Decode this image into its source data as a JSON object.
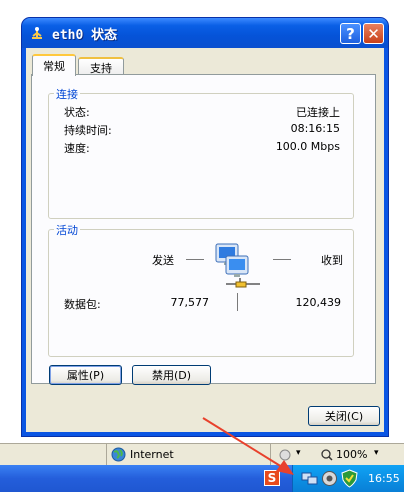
{
  "window": {
    "title": "eth0 状态",
    "help_label": "?",
    "close_label": "✕"
  },
  "tabs": [
    {
      "label": "常规"
    },
    {
      "label": "支持"
    }
  ],
  "connection": {
    "group_label": "连接",
    "rows": [
      {
        "label": "状态:",
        "value": "已连接上"
      },
      {
        "label": "持续时间:",
        "value": "08:16:15"
      },
      {
        "label": "速度:",
        "value": "100.0 Mbps"
      }
    ]
  },
  "activity": {
    "group_label": "活动",
    "sent_label": "发送",
    "received_label": "收到",
    "packets_label": "数据包:",
    "sent_packets": "77,577",
    "received_packets": "120,439"
  },
  "buttons": {
    "properties": "属性(P)",
    "disable": "禁用(D)",
    "close": "关闭(C)"
  },
  "statusbar": {
    "zone": "Internet",
    "zoom": "100%"
  },
  "taskbar": {
    "clock": "16:55"
  },
  "colors": {
    "title_bar": "#0553d8",
    "accent_tab": "#ffc83c",
    "group_label": "#0046d5",
    "annotation_arrow": "#e8412c"
  }
}
